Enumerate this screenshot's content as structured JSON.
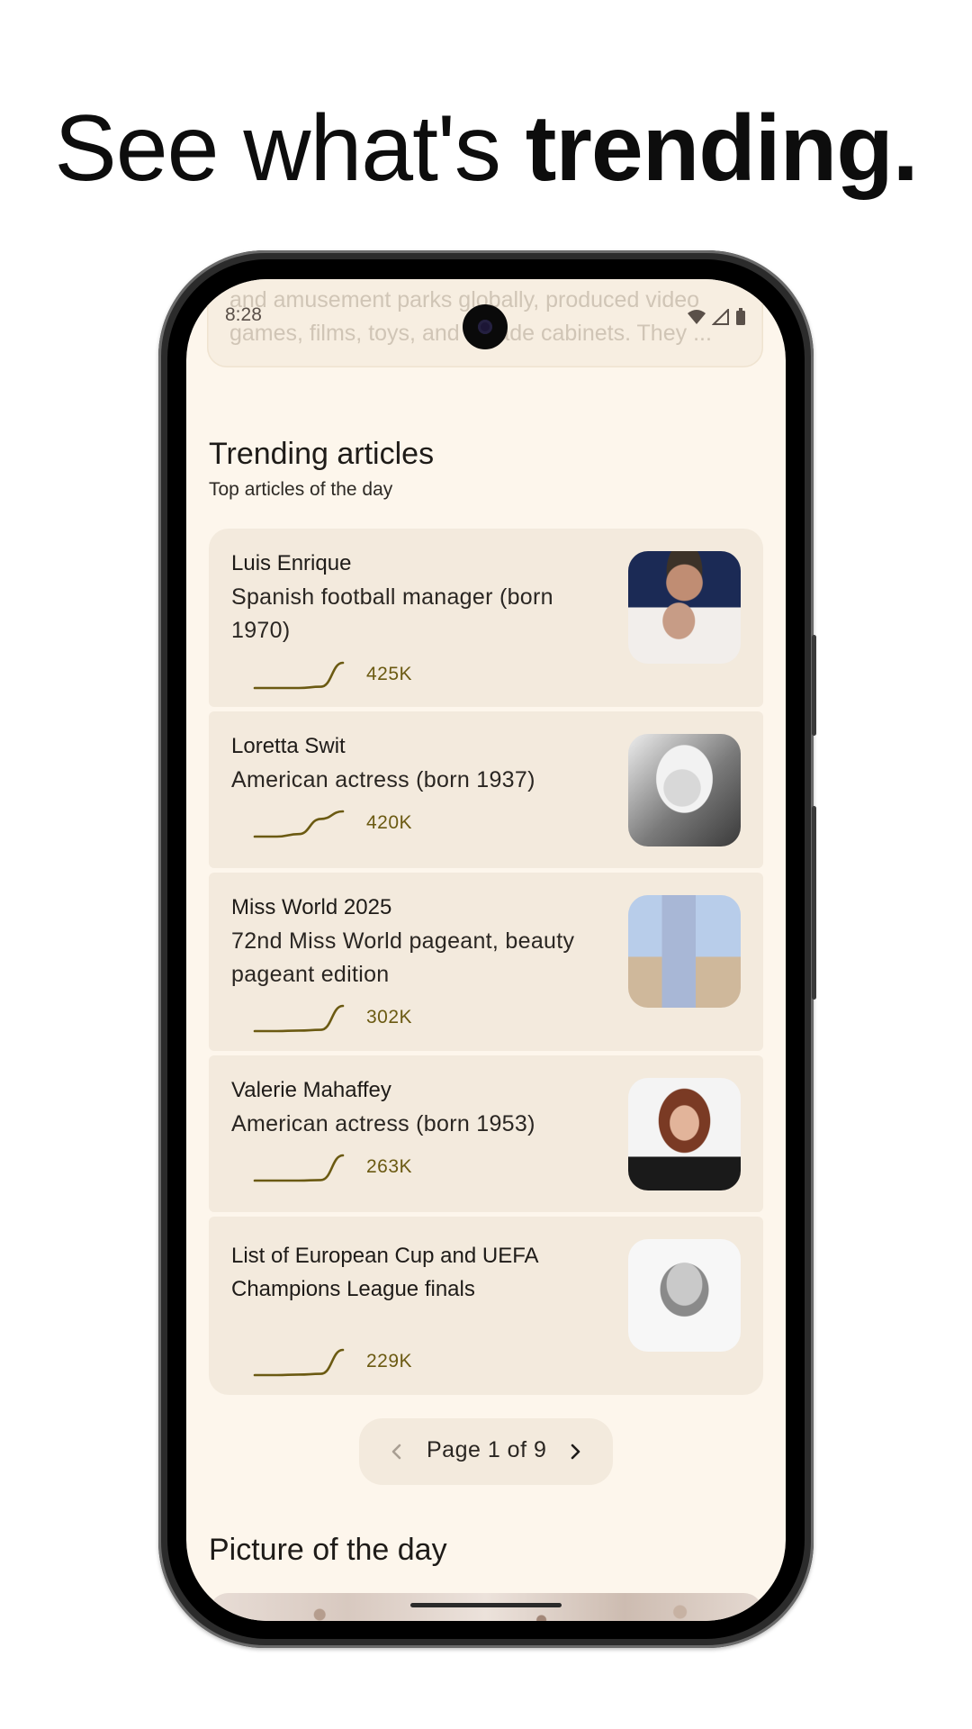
{
  "promo": {
    "headline_regular": "See what's ",
    "headline_bold": "trending."
  },
  "status_bar": {
    "time": "8:28",
    "icons": [
      "wifi-icon",
      "cellular-icon",
      "battery-icon"
    ]
  },
  "previous_card": {
    "line1": "and amusement parks globally, produced video",
    "line2": "games, films, toys, and arcade cabinets. They ..."
  },
  "trending": {
    "title": "Trending articles",
    "subtitle": "Top articles of the day",
    "articles": [
      {
        "title": "Luis Enrique",
        "description": "Spanish football manager (born 1970)",
        "views": "425K",
        "trend": [
          0,
          0,
          0,
          0.05,
          1
        ]
      },
      {
        "title": "Loretta Swit",
        "description": "American actress (born 1937)",
        "views": "420K",
        "trend": [
          0,
          0,
          0.1,
          0.7,
          1
        ]
      },
      {
        "title": "Miss World 2025",
        "description": "72nd Miss World pageant, beauty pageant edition",
        "views": "302K",
        "trend": [
          0,
          0,
          0.02,
          0.05,
          1
        ]
      },
      {
        "title": "Valerie Mahaffey",
        "description": "American actress (born 1953)",
        "views": "263K",
        "trend": [
          0,
          0,
          0,
          0.02,
          1
        ]
      },
      {
        "title": "List of European Cup and UEFA Champions League finals",
        "description": "",
        "views": "229K",
        "trend": [
          0,
          0,
          0.02,
          0.05,
          1
        ]
      }
    ]
  },
  "pager": {
    "label": "Page 1 of 9"
  },
  "picture_of_day": {
    "title": "Picture of the day"
  },
  "colors": {
    "background": "#fdf6ec",
    "card": "#f3eadd",
    "sparkline": "#6b5a12"
  }
}
